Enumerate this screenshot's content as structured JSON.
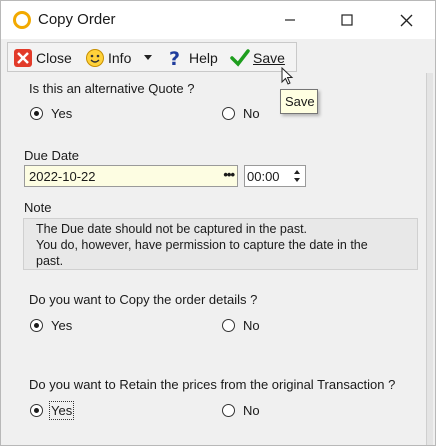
{
  "window": {
    "title": "Copy Order"
  },
  "toolbar": {
    "close_label": "Close",
    "info_label": "Info",
    "help_label": "Help",
    "save_label": "Save"
  },
  "tooltip": {
    "text": "Save"
  },
  "alt_quote": {
    "question": "Is this an alternative Quote ?",
    "yes": "Yes",
    "no": "No",
    "selected": "Yes"
  },
  "due_date": {
    "label": "Due Date",
    "date_value": "2022-10-22",
    "picker_glyph": "•••",
    "time_value": "00:00"
  },
  "note": {
    "label": "Note",
    "line1": "The Due date should not be captured in the past.",
    "line2": "You do, however, have permission to capture the date in the",
    "line3": "past."
  },
  "copy_details": {
    "question": "Do you want to Copy the order details ?",
    "yes": "Yes",
    "no": "No",
    "selected": "Yes"
  },
  "retain_prices": {
    "question": "Do you want to Retain the prices from the original Transaction ?",
    "yes": "Yes",
    "no": "No",
    "selected": "Yes"
  },
  "colors": {
    "date_bg": "#fdfde2",
    "tooltip_bg": "#ffffe1",
    "save_check": "#1e9e1e",
    "close_icon": "#e23b2a"
  }
}
